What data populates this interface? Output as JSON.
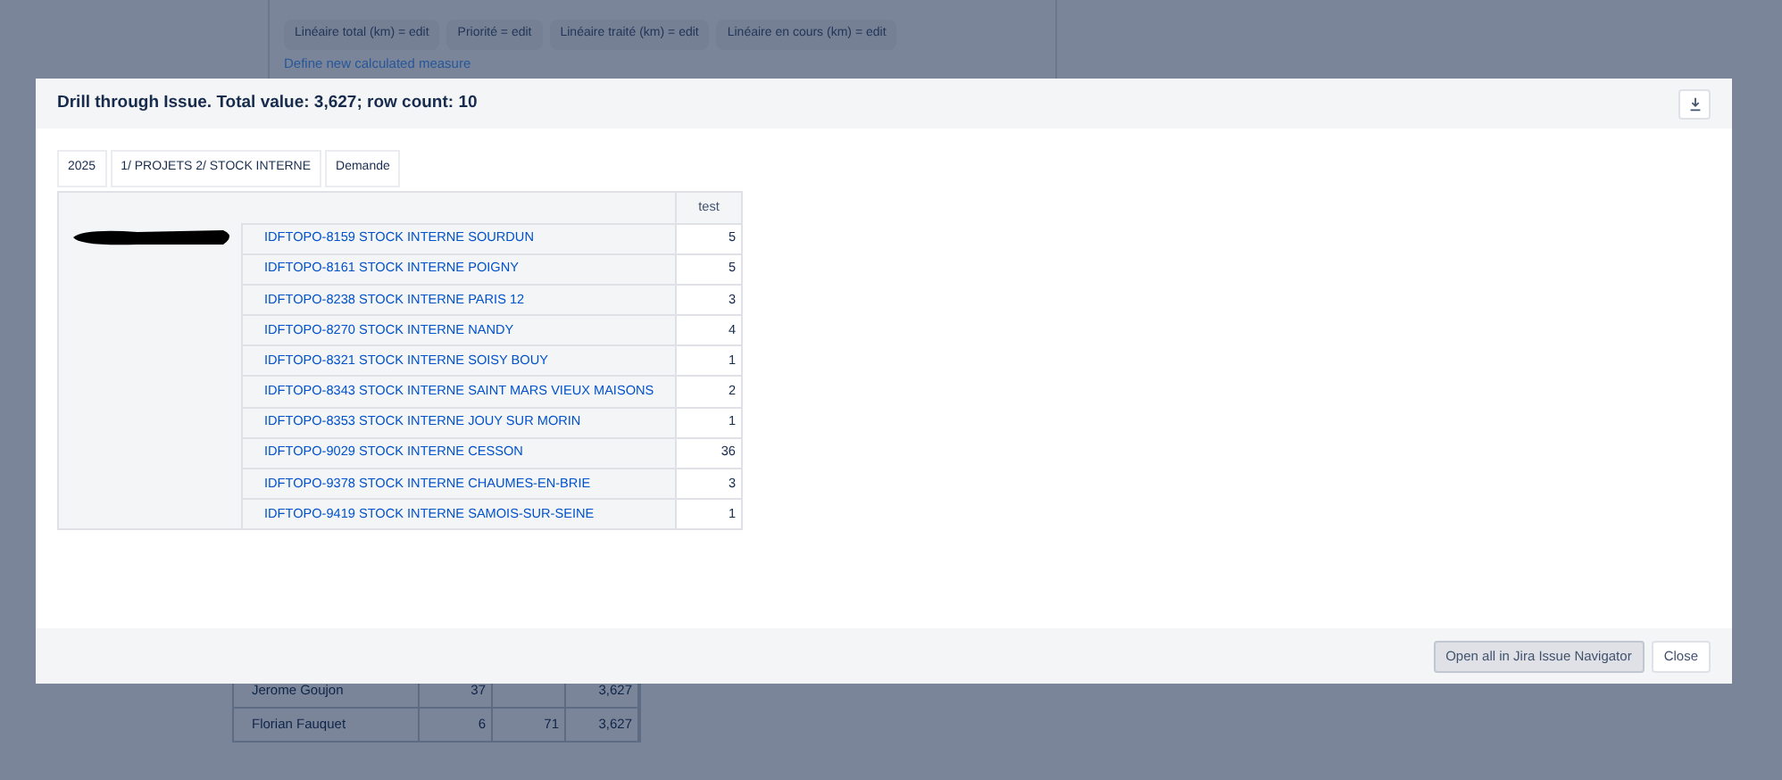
{
  "background": {
    "measure_rows": [
      [
        "Linéaire total (km) = edit",
        "Priorité = edit",
        "Linéaire traité (km) = edit",
        "Linéaire en cours (km) = edit"
      ]
    ],
    "define_link": "Define new calculated measure",
    "rows": [
      [
        "Jerome Goujon",
        "37",
        "",
        "3,627"
      ],
      [
        "Florian Fauquet",
        "6",
        "71",
        "3,627"
      ]
    ]
  },
  "dialog": {
    "title": "Drill through Issue. Total value: 3,627; row count: 10",
    "filters": [
      "2025",
      "1/ PROJETS 2/ STOCK INTERNE",
      "Demande"
    ],
    "table": {
      "value_column": "test",
      "rows": [
        {
          "issue": "IDFTOPO-8159 STOCK INTERNE SOURDUN",
          "value": "5"
        },
        {
          "issue": "IDFTOPO-8161 STOCK INTERNE POIGNY",
          "value": "5"
        },
        {
          "issue": "IDFTOPO-8238 STOCK INTERNE PARIS 12",
          "value": "3"
        },
        {
          "issue": "IDFTOPO-8270 STOCK INTERNE NANDY",
          "value": "4"
        },
        {
          "issue": "IDFTOPO-8321 STOCK INTERNE SOISY BOUY",
          "value": "1"
        },
        {
          "issue": "IDFTOPO-8343 STOCK INTERNE SAINT MARS VIEUX MAISONS",
          "value": "2"
        },
        {
          "issue": "IDFTOPO-8353 STOCK INTERNE JOUY SUR MORIN",
          "value": "1"
        },
        {
          "issue": "IDFTOPO-9029 STOCK INTERNE CESSON",
          "value": "36"
        },
        {
          "issue": "IDFTOPO-9378 STOCK INTERNE CHAUMES-EN-BRIE",
          "value": "3"
        },
        {
          "issue": "IDFTOPO-9419 STOCK INTERNE SAMOIS-SUR-SEINE",
          "value": "1"
        }
      ]
    },
    "buttons": [
      {
        "label": "Open all in Jira Issue Navigator",
        "kind": "primary"
      },
      {
        "label": "Close",
        "kind": "secondary"
      }
    ]
  }
}
